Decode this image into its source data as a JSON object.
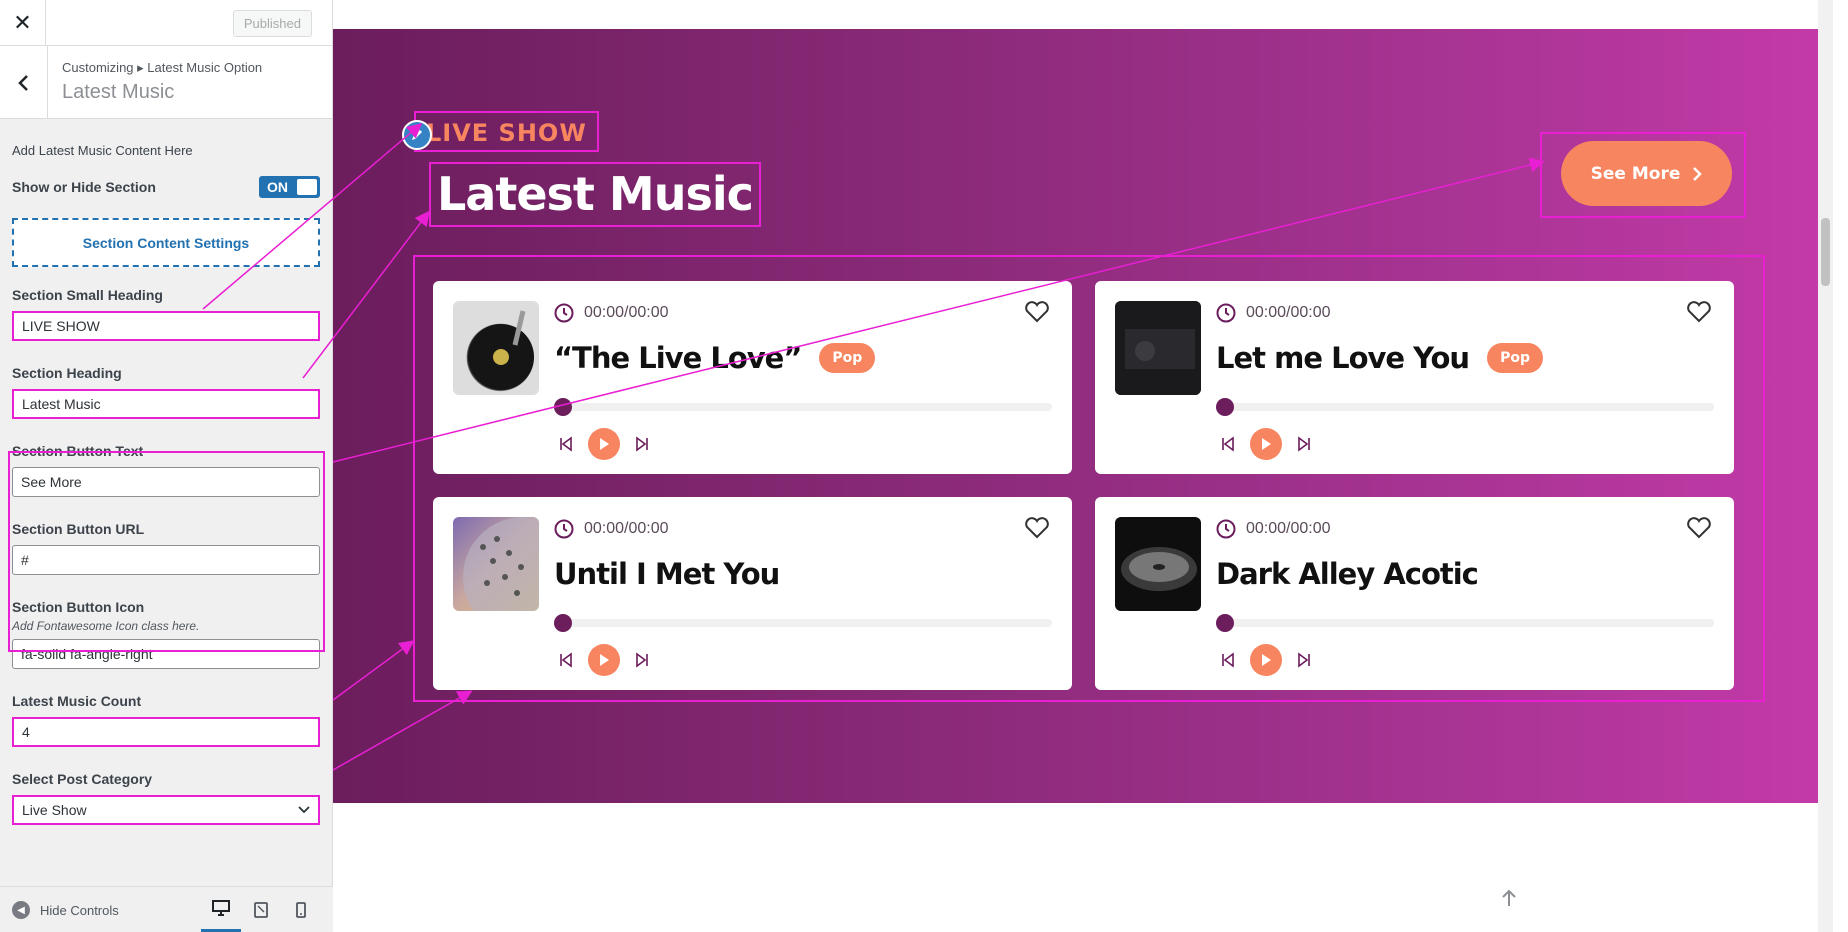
{
  "topbar": {
    "close_label": "✕",
    "published_label": "Published"
  },
  "section": {
    "breadcrumb": "Customizing ▸ Latest Music Option",
    "title": "Latest Music"
  },
  "controls": {
    "description": "Add Latest Music Content Here",
    "show_hide_label": "Show or Hide Section",
    "toggle_text": "ON",
    "content_settings_label": "Section Content Settings",
    "small_heading_label": "Section Small Heading",
    "small_heading_value": "LIVE SHOW",
    "heading_label": "Section Heading",
    "heading_value": "Latest Music",
    "button_text_label": "Section Button Text",
    "button_text_value": "See More",
    "button_url_label": "Section Button URL",
    "button_url_value": "#",
    "button_icon_label": "Section Button Icon",
    "button_icon_hint": "Add Fontawesome Icon class here.",
    "button_icon_value": "fa-solid fa-angle-right",
    "count_label": "Latest Music Count",
    "count_value": "4",
    "category_label": "Select Post Category",
    "category_value": "Live Show"
  },
  "footer": {
    "hide_controls_label": "Hide Controls"
  },
  "preview": {
    "small_heading": "LIVE SHOW",
    "heading": "Latest Music",
    "button_label": "See More",
    "cards": [
      {
        "time": "00:00/00:00",
        "title": "“The Live Love”",
        "tag": "Pop"
      },
      {
        "time": "00:00/00:00",
        "title": "Let me Love You",
        "tag": "Pop"
      },
      {
        "time": "00:00/00:00",
        "title": "Until I Met You",
        "tag": ""
      },
      {
        "time": "00:00/00:00",
        "title": "Dark Alley Acotic",
        "tag": ""
      }
    ]
  },
  "colors": {
    "accent": "#f7855f",
    "highlight": "#e91fd3",
    "wp_blue": "#2271b1",
    "band_start": "#6b1d5c",
    "band_end": "#c43aa9"
  }
}
